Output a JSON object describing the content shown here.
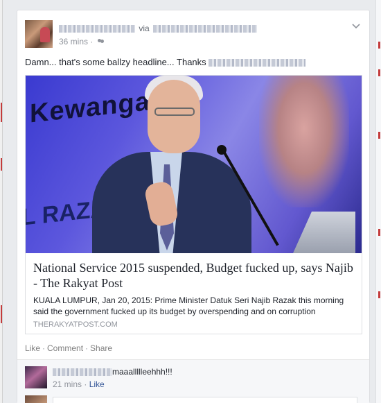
{
  "post": {
    "author_via": "via",
    "time": "36 mins",
    "text": "Damn... that's some ballzy headline... Thanks"
  },
  "link": {
    "image_banner_text": "Kewangan N",
    "image_banner_text2": "L RAZAK",
    "title": "National Service 2015 suspended, Budget fucked up, says Najib - The Rakyat Post",
    "description": "KUALA LUMPUR, Jan 20, 2015: Prime Minister Datuk Seri Najib Razak this morning said the government fucked up its budget by overspending and on corruption",
    "domain": "THERAKYATPOST.COM"
  },
  "actions": {
    "like": "Like",
    "comment": "Comment",
    "share": "Share",
    "separator": "·"
  },
  "comment": {
    "text": "maaallllleehhh!!!",
    "time": "21 mins",
    "separator": "·",
    "like": "Like"
  },
  "colors": {
    "link_blue": "#365899",
    "meta_gray": "#90949c"
  }
}
